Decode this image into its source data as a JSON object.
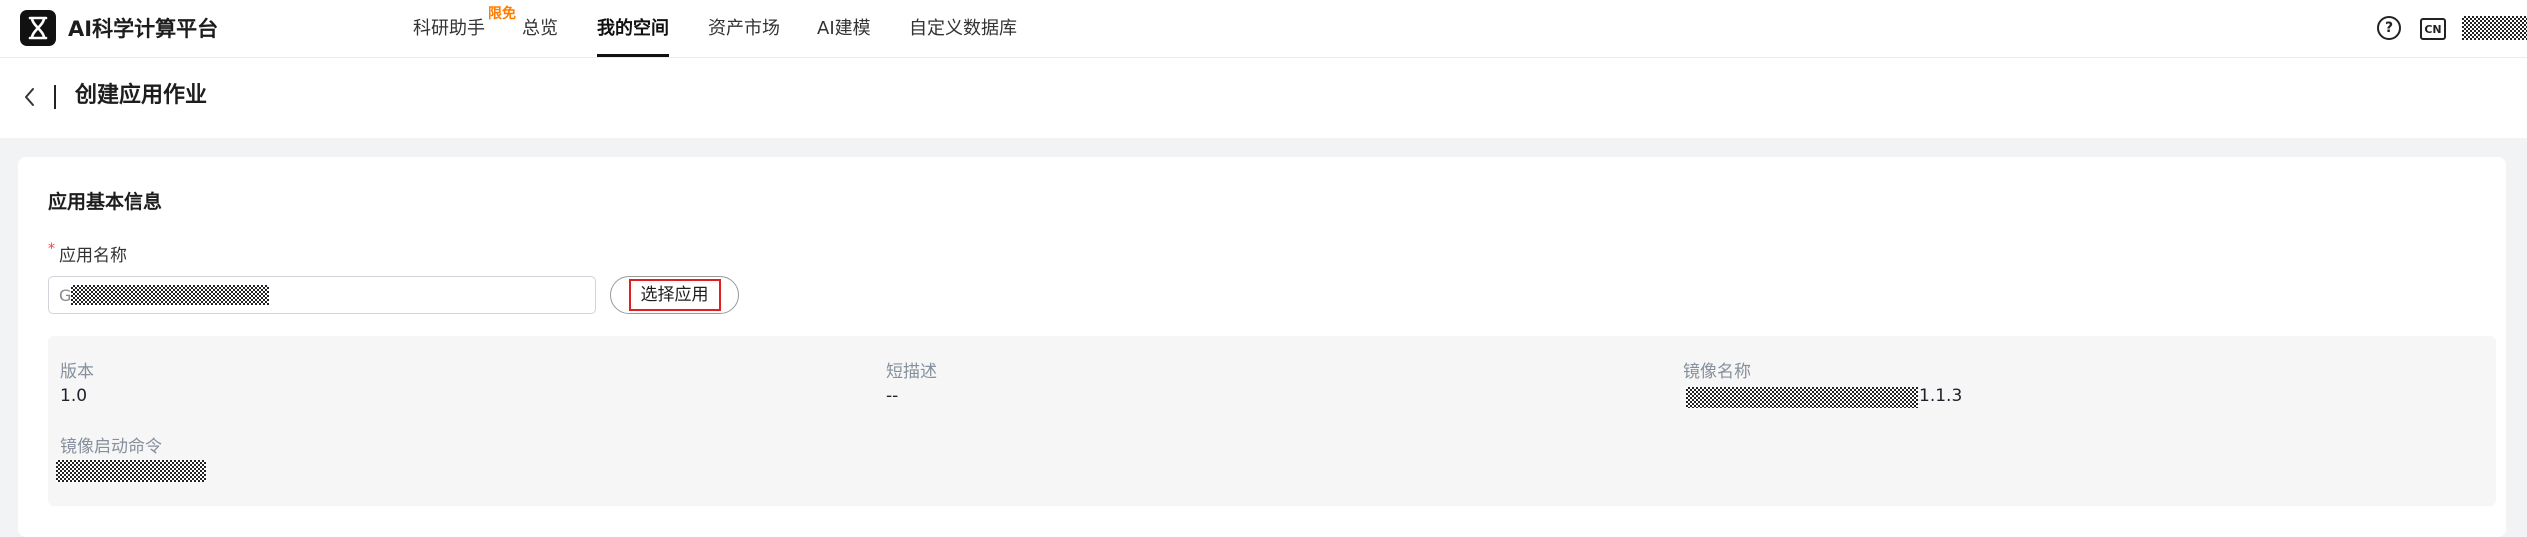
{
  "brand": {
    "name": "AI科学计算平台"
  },
  "nav": {
    "items": [
      {
        "label": "科研助手"
      },
      {
        "label": "总览"
      },
      {
        "label": "我的空间"
      },
      {
        "label": "资产市场"
      },
      {
        "label": "AI建模"
      },
      {
        "label": "自定义数据库"
      }
    ],
    "badge": "限免",
    "active": "我的空间"
  },
  "header_icons": {
    "help": "?",
    "language": "CN"
  },
  "page": {
    "title": "创建应用作业"
  },
  "section": {
    "title": "应用基本信息"
  },
  "form": {
    "app_name_label": "应用名称",
    "required_mark": "*",
    "app_name_value_prefix": "G",
    "select_button": "选择应用"
  },
  "info": {
    "version_label": "版本",
    "version_value": "1.0",
    "short_desc_label": "短描述",
    "short_desc_value": "--",
    "image_name_label": "镜像名称",
    "image_name_suffix": "1.1.3",
    "image_cmd_label": "镜像启动命令"
  },
  "colors": {
    "accent": "#111111",
    "badge": "#ff7d00",
    "required": "#f53f3f",
    "highlight_border": "#e02020"
  }
}
